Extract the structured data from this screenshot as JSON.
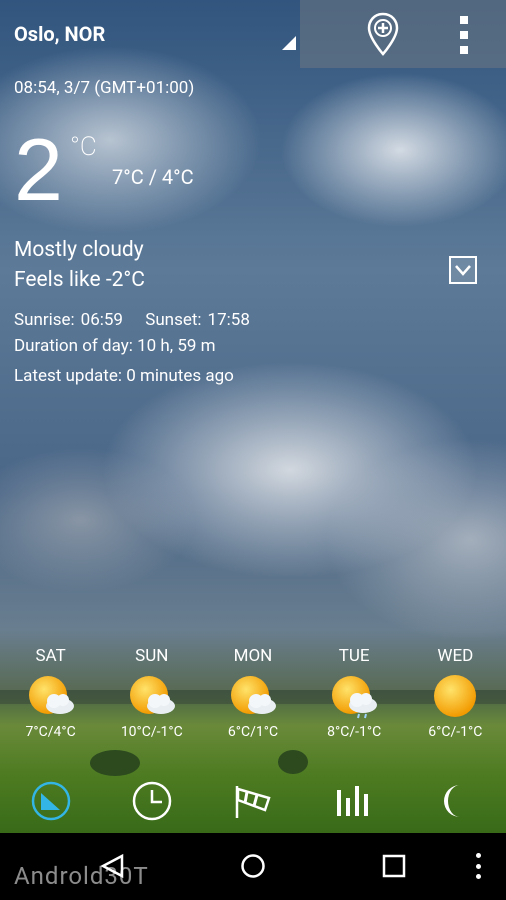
{
  "header": {
    "location": "Oslo, NOR"
  },
  "current": {
    "datetime": "08:54, 3/7 (GMT+01:00)",
    "temperature": "2",
    "unit": "°C",
    "range": "7°C / 4°C",
    "condition": "Mostly cloudy",
    "feels_like": "Feels like -2°C",
    "sunrise_label": "Sunrise:",
    "sunrise": "06:59",
    "sunset_label": "Sunset:",
    "sunset": "17:58",
    "duration": "Duration of day: 10 h, 59 m",
    "latest_update": "Latest update: 0 minutes ago"
  },
  "forecast": [
    {
      "day": "SAT",
      "range": "7°C/4°C",
      "icon": "partly-cloudy-icon"
    },
    {
      "day": "SUN",
      "range": "10°C/-1°C",
      "icon": "partly-cloudy-icon"
    },
    {
      "day": "MON",
      "range": "6°C/1°C",
      "icon": "partly-cloudy-icon"
    },
    {
      "day": "TUE",
      "range": "8°C/-1°C",
      "icon": "partly-cloudy-rain-icon"
    },
    {
      "day": "WED",
      "range": "6°C/-1°C",
      "icon": "sunny-icon"
    }
  ],
  "bottom_nav": [
    {
      "icon": "current-weather-icon",
      "active": true
    },
    {
      "icon": "clock-icon",
      "active": false
    },
    {
      "icon": "windsock-icon",
      "active": false
    },
    {
      "icon": "bar-chart-icon",
      "active": false
    },
    {
      "icon": "moon-icon",
      "active": false
    }
  ],
  "watermark": "Androld30T",
  "colors": {
    "accent": "#33b5e5",
    "sun": "#f7b500",
    "system_bar": "#000000"
  }
}
